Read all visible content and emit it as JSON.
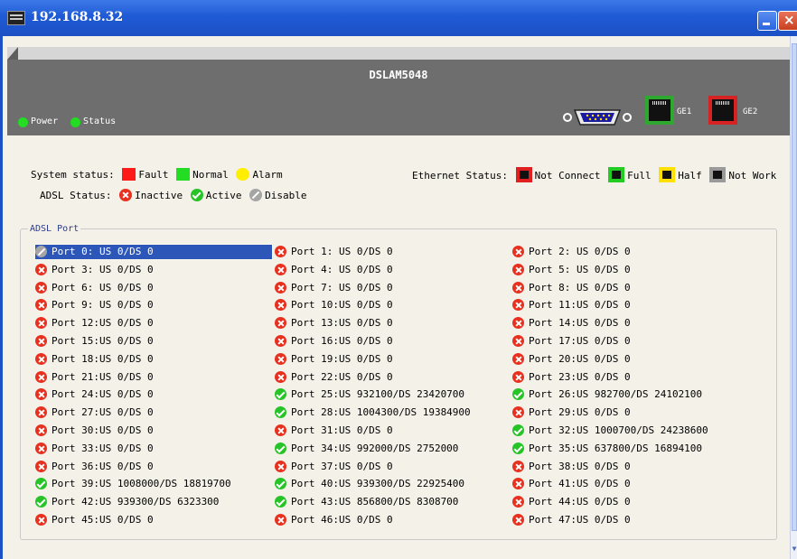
{
  "window": {
    "title": "192.168.8.32"
  },
  "device": {
    "model": "DSLAM5048",
    "leds": [
      "Power",
      "Status"
    ],
    "ge_ports": [
      "GE1",
      "GE2"
    ]
  },
  "legend": {
    "system_label": "System status:",
    "system_items": [
      "Fault",
      "Normal",
      "Alarm"
    ],
    "adsl_label": "ADSL Status:",
    "adsl_items": [
      "Inactive",
      "Active",
      "Disable"
    ],
    "ethernet_label": "Ethernet Status:",
    "ethernet_items": [
      "Not Connect",
      "Full",
      "Half",
      "Not Work"
    ]
  },
  "colors": {
    "fault": "#ff1a1a",
    "normal": "#22dd22",
    "alarm": "#ffee00",
    "ge1": "#2ea82e",
    "ge2": "#d62222",
    "selection": "#2c57b8"
  },
  "ports_group": {
    "title": "ADSL Port"
  },
  "ports": [
    {
      "label": "Port 0: US 0/DS 0",
      "status": "disable"
    },
    {
      "label": "Port 1: US 0/DS 0",
      "status": "inactive"
    },
    {
      "label": "Port 2: US 0/DS 0",
      "status": "inactive"
    },
    {
      "label": "Port 3: US 0/DS 0",
      "status": "inactive"
    },
    {
      "label": "Port 4: US 0/DS 0",
      "status": "inactive"
    },
    {
      "label": "Port 5: US 0/DS 0",
      "status": "inactive"
    },
    {
      "label": "Port 6: US 0/DS 0",
      "status": "inactive"
    },
    {
      "label": "Port 7: US 0/DS 0",
      "status": "inactive"
    },
    {
      "label": "Port 8: US 0/DS 0",
      "status": "inactive"
    },
    {
      "label": "Port 9: US 0/DS 0",
      "status": "inactive"
    },
    {
      "label": "Port 10:US 0/DS 0",
      "status": "inactive"
    },
    {
      "label": "Port 11:US 0/DS 0",
      "status": "inactive"
    },
    {
      "label": "Port 12:US 0/DS 0",
      "status": "inactive"
    },
    {
      "label": "Port 13:US 0/DS 0",
      "status": "inactive"
    },
    {
      "label": "Port 14:US 0/DS 0",
      "status": "inactive"
    },
    {
      "label": "Port 15:US 0/DS 0",
      "status": "inactive"
    },
    {
      "label": "Port 16:US 0/DS 0",
      "status": "inactive"
    },
    {
      "label": "Port 17:US 0/DS 0",
      "status": "inactive"
    },
    {
      "label": "Port 18:US 0/DS 0",
      "status": "inactive"
    },
    {
      "label": "Port 19:US 0/DS 0",
      "status": "inactive"
    },
    {
      "label": "Port 20:US 0/DS 0",
      "status": "inactive"
    },
    {
      "label": "Port 21:US 0/DS 0",
      "status": "inactive"
    },
    {
      "label": "Port 22:US 0/DS 0",
      "status": "inactive"
    },
    {
      "label": "Port 23:US 0/DS 0",
      "status": "inactive"
    },
    {
      "label": "Port 24:US 0/DS 0",
      "status": "inactive"
    },
    {
      "label": "Port 25:US 932100/DS 23420700",
      "status": "active"
    },
    {
      "label": "Port 26:US 982700/DS 24102100",
      "status": "active"
    },
    {
      "label": "Port 27:US 0/DS 0",
      "status": "inactive"
    },
    {
      "label": "Port 28:US 1004300/DS 19384900",
      "status": "active"
    },
    {
      "label": "Port 29:US 0/DS 0",
      "status": "inactive"
    },
    {
      "label": "Port 30:US 0/DS 0",
      "status": "inactive"
    },
    {
      "label": "Port 31:US 0/DS 0",
      "status": "inactive"
    },
    {
      "label": "Port 32:US 1000700/DS 24238600",
      "status": "active"
    },
    {
      "label": "Port 33:US 0/DS 0",
      "status": "inactive"
    },
    {
      "label": "Port 34:US 992000/DS 2752000",
      "status": "active"
    },
    {
      "label": "Port 35:US 637800/DS 16894100",
      "status": "active"
    },
    {
      "label": "Port 36:US 0/DS 0",
      "status": "inactive"
    },
    {
      "label": "Port 37:US 0/DS 0",
      "status": "inactive"
    },
    {
      "label": "Port 38:US 0/DS 0",
      "status": "inactive"
    },
    {
      "label": "Port 39:US 1008000/DS 18819700",
      "status": "active"
    },
    {
      "label": "Port 40:US 939300/DS 22925400",
      "status": "active"
    },
    {
      "label": "Port 41:US 0/DS 0",
      "status": "inactive"
    },
    {
      "label": "Port 42:US 939300/DS 6323300",
      "status": "active"
    },
    {
      "label": "Port 43:US 856800/DS 8308700",
      "status": "active"
    },
    {
      "label": "Port 44:US 0/DS 0",
      "status": "inactive"
    },
    {
      "label": "Port 45:US 0/DS 0",
      "status": "inactive"
    },
    {
      "label": "Port 46:US 0/DS 0",
      "status": "inactive"
    },
    {
      "label": "Port 47:US 0/DS 0",
      "status": "inactive"
    }
  ]
}
